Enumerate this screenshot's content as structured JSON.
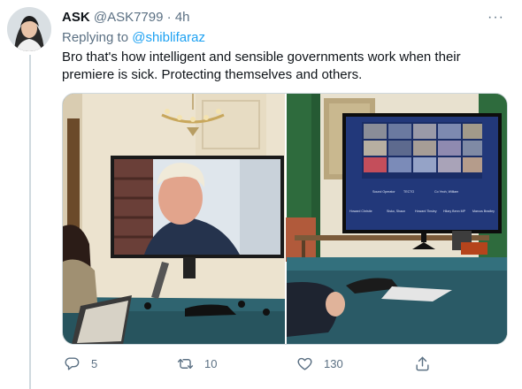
{
  "tweet": {
    "display_name": "ASK",
    "handle": "@ASK7799",
    "separator": "·",
    "time": "4h",
    "more_label": "···",
    "replying_prefix": "Replying to ",
    "replying_handle": "@shiblifaraz",
    "text": "Bro that's how intelligent and  sensible governments work when their premiere is sick. Protecting themselves and others."
  },
  "actions": {
    "reply_count": "5",
    "retweet_count": "10",
    "like_count": "130",
    "reply_icon": "reply-icon",
    "retweet_icon": "retweet-icon",
    "like_icon": "heart-icon",
    "share_icon": "share-icon"
  },
  "media": {
    "video_call_labels": [
      "Sound Operator",
      "TECTO",
      "Co Yeoh, William",
      "Howard Christie",
      "Sisko, Shaun",
      "Howard Tinsley",
      "Hilary Benn MP",
      "Marcus Bradley"
    ]
  },
  "colors": {
    "link": "#1da1f2",
    "secondary_text": "#5b7083",
    "primary_text": "#0f1419",
    "thread_line": "#cfd9de"
  }
}
